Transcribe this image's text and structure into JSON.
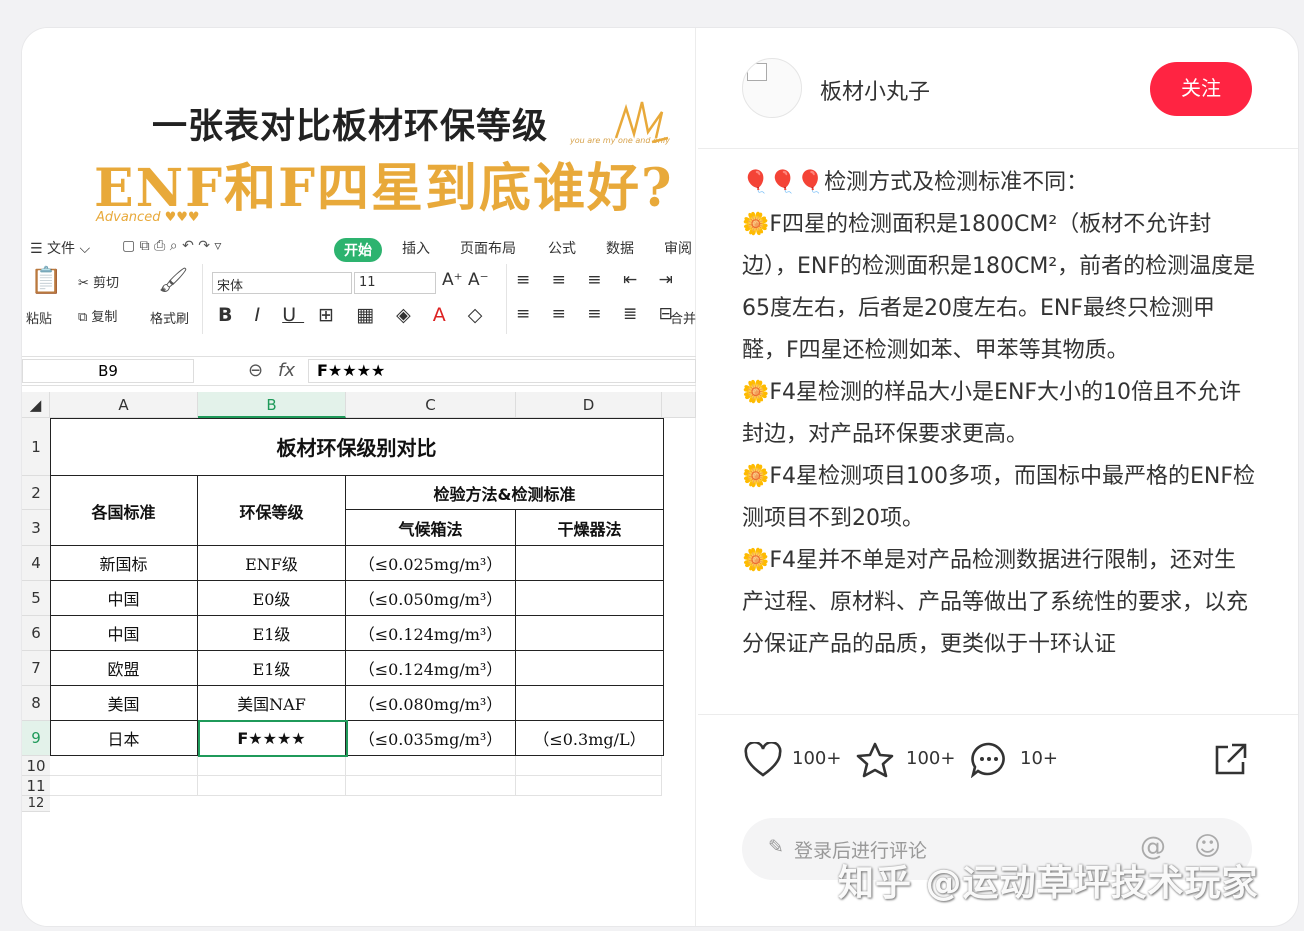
{
  "image": {
    "title_line1": "一张表对比板材环保等级",
    "title_line2": "ENF和F四星到底谁好?",
    "advanced": "Advanced ♥♥♥",
    "tagline": "you are my one and only",
    "menu": {
      "file": "文件",
      "tabs": [
        "开始",
        "插入",
        "页面布局",
        "公式",
        "数据",
        "审阅"
      ]
    },
    "ribbon": {
      "paste": "粘贴",
      "cut": "剪切",
      "copy": "复制",
      "format_painter": "格式刷",
      "font": "宋体",
      "size": "11",
      "merge": "合并"
    },
    "formula_bar": {
      "name_box": "B9",
      "fx": "fx",
      "value": "F★★★★"
    },
    "sheet": {
      "columns": [
        "A",
        "B",
        "C",
        "D"
      ],
      "rows": [
        "1",
        "2",
        "3",
        "4",
        "5",
        "6",
        "7",
        "8",
        "9",
        "10",
        "11",
        "12"
      ],
      "title": "板材环保级别对比",
      "header_standard": "各国标准",
      "header_grade": "环保等级",
      "header_method": "检验方法&检测标准",
      "header_climate": "气候箱法",
      "header_dryer": "干燥器法",
      "data_rows": [
        {
          "standard": "新国标",
          "grade": "ENF级",
          "climate": "（≤0.025mg/m³）",
          "dryer": ""
        },
        {
          "standard": "中国",
          "grade": "E0级",
          "climate": "（≤0.050mg/m³）",
          "dryer": ""
        },
        {
          "standard": "中国",
          "grade": "E1级",
          "climate": "（≤0.124mg/m³）",
          "dryer": ""
        },
        {
          "standard": "欧盟",
          "grade": "E1级",
          "climate": "（≤0.124mg/m³）",
          "dryer": ""
        },
        {
          "standard": "美国",
          "grade": "美国NAF",
          "climate": "（≤0.080mg/m³）",
          "dryer": ""
        },
        {
          "standard": "日本",
          "grade": "F★★★★",
          "climate": "（≤0.035mg/m³）",
          "dryer": "（≤0.3mg/L）"
        }
      ]
    }
  },
  "post": {
    "author": "板材小丸子",
    "follow_label": "关注",
    "paragraphs": [
      "🎈🎈🎈检测方式及检测标准不同：",
      "🌼F四星的检测面积是1800CM²（板材不允许封边），ENF的检测面积是180CM²，前者的检测温度是65度左右，后者是20度左右。ENF最终只检测甲醛，F四星还检测如苯、甲苯等其物质。",
      "🌼F4星检测的样品大小是ENF大小的10倍且不允许封边，对产品环保要求更高。",
      "🌼F4星检测项目100多项，而国标中最严格的ENF检测项目不到20项。",
      "🌼F4星并不单是对产品检测数据进行限制，还对生产过程、原材料、产品等做出了系统性的要求，以充分保证产品的品质，更类似于十环认证"
    ],
    "likes": "100+",
    "favorites": "100+",
    "comments": "10+",
    "comment_placeholder": "登录后进行评论",
    "watermark": "知乎 @运动草坪技术玩家"
  }
}
